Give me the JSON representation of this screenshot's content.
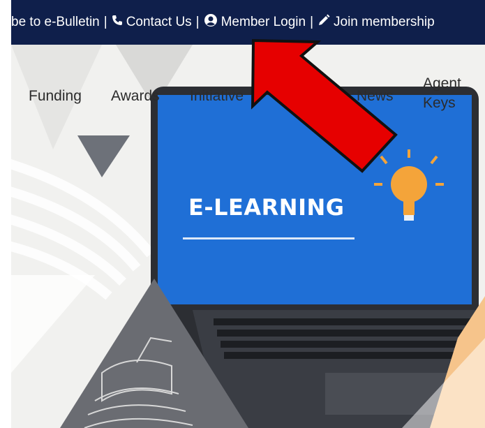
{
  "topbar": {
    "subscribe_label": "be to e-Bulletin",
    "separator": "|",
    "contact_label": "Contact Us",
    "member_login_label": "Member Login",
    "join_label": "Join membership",
    "icons": [
      "phone-icon",
      "user-circle-icon",
      "pencil-icon"
    ]
  },
  "nav": {
    "items": [
      {
        "label": "Funding"
      },
      {
        "label": "Awards"
      },
      {
        "label": "Initiative"
      },
      {
        "label": "News"
      },
      {
        "label_line1": "Agent",
        "label_line2": "Keys"
      }
    ]
  },
  "hero": {
    "screen_text": "E-LEARNING"
  },
  "colors": {
    "topbar_bg": "#0f1f4b",
    "screen_blue": "#1f6fd6",
    "arrow_red": "#e60000",
    "bulb_orange": "#f4a43a"
  }
}
